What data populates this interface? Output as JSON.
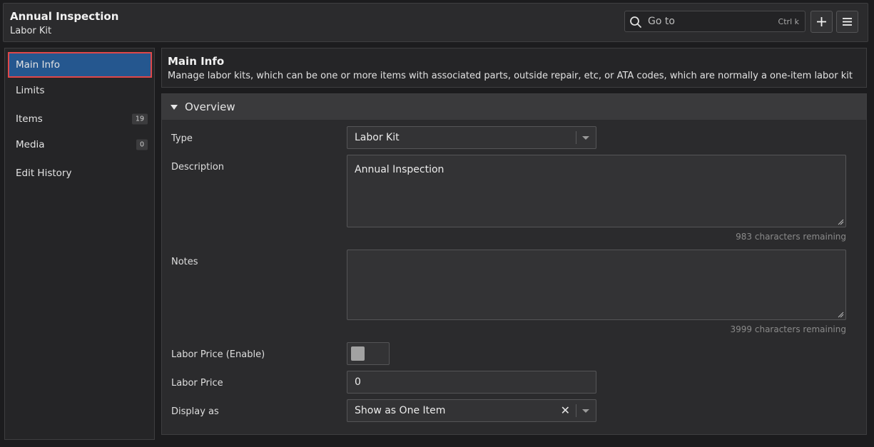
{
  "header": {
    "title": "Annual Inspection",
    "subtitle": "Labor Kit",
    "goto_placeholder": "Go to",
    "goto_shortcut": "Ctrl k"
  },
  "sidebar": {
    "items": [
      {
        "label": "Main Info",
        "active": true
      },
      {
        "label": "Limits"
      },
      {
        "label": "Items",
        "badge": "19"
      },
      {
        "label": "Media",
        "badge": "0"
      },
      {
        "label": "Edit History"
      }
    ]
  },
  "main": {
    "title": "Main Info",
    "description": "Manage labor kits, which can be one or more items with associated parts, outside repair, etc, or ATA codes, which are normally a one-item labor kit"
  },
  "overview": {
    "title": "Overview",
    "fields": {
      "type": {
        "label": "Type",
        "value": "Labor Kit"
      },
      "description": {
        "label": "Description",
        "value": "Annual Inspection",
        "remaining": "983 characters remaining"
      },
      "notes": {
        "label": "Notes",
        "value": "",
        "remaining": "3999 characters remaining"
      },
      "labor_price_enable": {
        "label": "Labor Price (Enable)",
        "enabled": false
      },
      "labor_price": {
        "label": "Labor Price",
        "value": "0"
      },
      "display_as": {
        "label": "Display as",
        "value": "Show as One Item"
      }
    }
  },
  "colors": {
    "active_item": "#25578f",
    "active_outline": "#e0484a",
    "background": "#1c1c1e"
  }
}
